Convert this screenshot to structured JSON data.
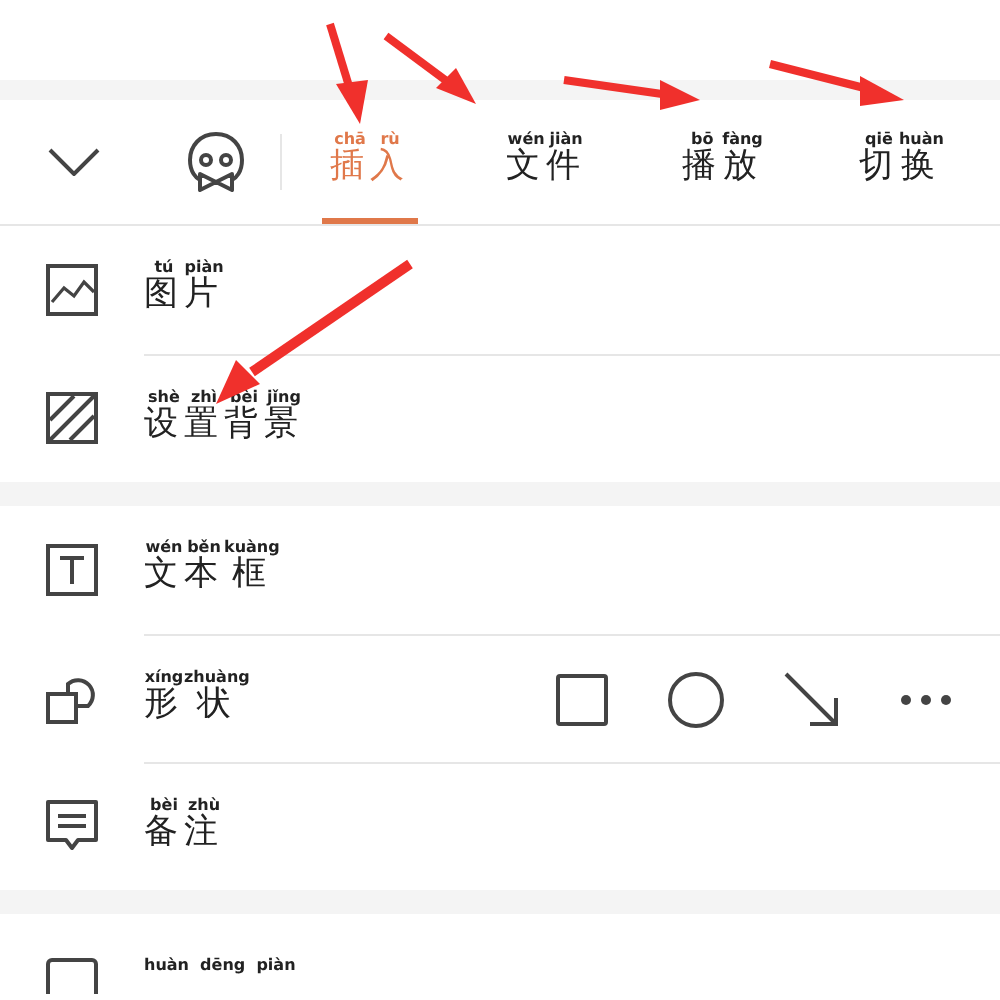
{
  "toolbar": {
    "tabs": [
      {
        "chars": [
          {
            "han": "插",
            "pinyin": "chā"
          },
          {
            "han": "入",
            "pinyin": "rù"
          }
        ],
        "selected": true
      },
      {
        "chars": [
          {
            "han": "文",
            "pinyin": "wén"
          },
          {
            "han": "件",
            "pinyin": "jiàn"
          }
        ],
        "selected": false
      },
      {
        "chars": [
          {
            "han": "播",
            "pinyin": "bō"
          },
          {
            "han": "放",
            "pinyin": "fàng"
          }
        ],
        "selected": false
      },
      {
        "chars": [
          {
            "han": "切",
            "pinyin": "qiē"
          },
          {
            "han": "换",
            "pinyin": "huàn"
          }
        ],
        "selected": false
      }
    ]
  },
  "sections": [
    {
      "items": [
        {
          "kind": "picture",
          "chars": [
            {
              "han": "图",
              "pinyin": "tú"
            },
            {
              "han": "片",
              "pinyin": "piàn"
            }
          ]
        },
        {
          "kind": "background",
          "chars": [
            {
              "han": "设",
              "pinyin": "shè"
            },
            {
              "han": "置",
              "pinyin": "zhì"
            },
            {
              "han": "背",
              "pinyin": "bèi"
            },
            {
              "han": "景",
              "pinyin": "jǐng"
            }
          ]
        }
      ]
    },
    {
      "items": [
        {
          "kind": "textbox",
          "chars": [
            {
              "han": "文",
              "pinyin": "wén"
            },
            {
              "han": "本",
              "pinyin": "běn"
            },
            {
              "han": "框",
              "pinyin": "kuàng"
            }
          ]
        },
        {
          "kind": "shape",
          "chars": [
            {
              "han": "形",
              "pinyin": "xíng"
            },
            {
              "han": "状",
              "pinyin": "zhuàng"
            }
          ]
        },
        {
          "kind": "note",
          "chars": [
            {
              "han": "备",
              "pinyin": "bèi"
            },
            {
              "han": "注",
              "pinyin": "zhù"
            }
          ]
        }
      ]
    },
    {
      "items": [
        {
          "kind": "slide",
          "pinyin_only": "huàn  dēng  piàn"
        }
      ]
    }
  ]
}
